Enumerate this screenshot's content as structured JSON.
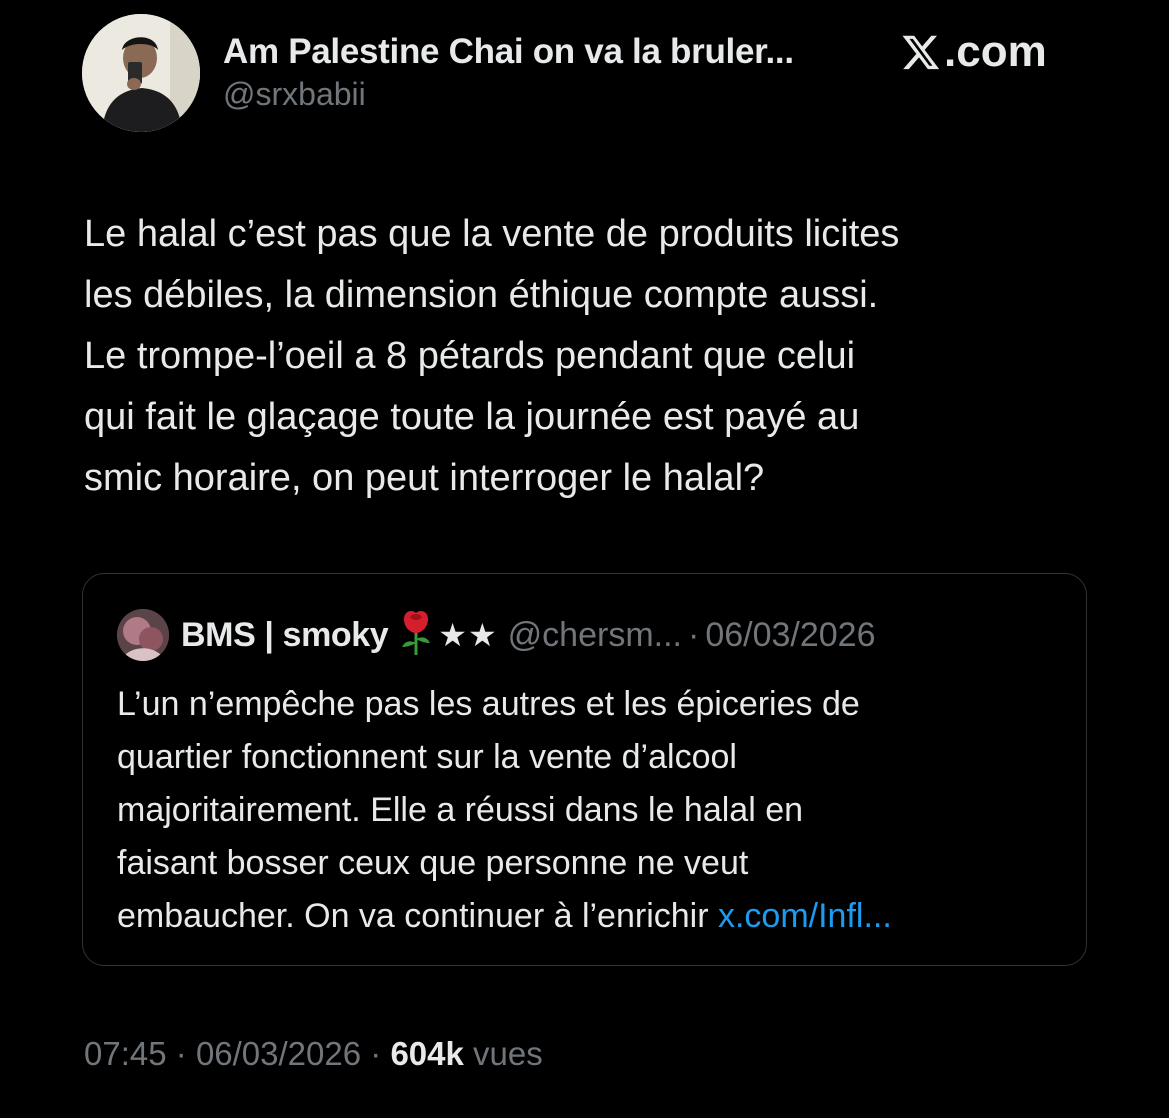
{
  "author": {
    "display_name": "Am Palestine Chai on va la bruler...",
    "handle": "@srxbabii"
  },
  "brand": {
    "label": ".com",
    "icon": "x-logo-icon"
  },
  "tweet": {
    "lines": [
      "Le halal c’est pas que la vente de produits licites",
      "les débiles, la dimension éthique compte aussi.",
      "Le trompe-l’oeil a 8 pétards pendant que celui",
      "qui fait le glaçage toute la journée est payé au",
      "smic horaire, on peut interroger le halal?"
    ]
  },
  "quote": {
    "name": "BMS | smoky",
    "emoji_icon": "rose-icon",
    "stars": "★★",
    "handle": "@chersm...",
    "separator": "·",
    "date": "06/03/2026",
    "lines": [
      "L’un n’empêche pas les autres et les épiceries de",
      "quartier fonctionnent sur la vente d’alcool",
      "majoritairement. Elle a réussi dans le halal en",
      "faisant bosser ceux que personne ne veut",
      "embaucher. On va continuer à l’enrichir "
    ],
    "link": "x.com/Infl..."
  },
  "meta": {
    "time": "07:45",
    "separator": "·",
    "date": "06/03/2026",
    "views_count": "604k",
    "views_label": "vues"
  },
  "colors": {
    "background": "#000000",
    "text": "#e7e9ea",
    "muted": "#71767b",
    "link": "#1d9bf0",
    "border": "#2f3336"
  }
}
